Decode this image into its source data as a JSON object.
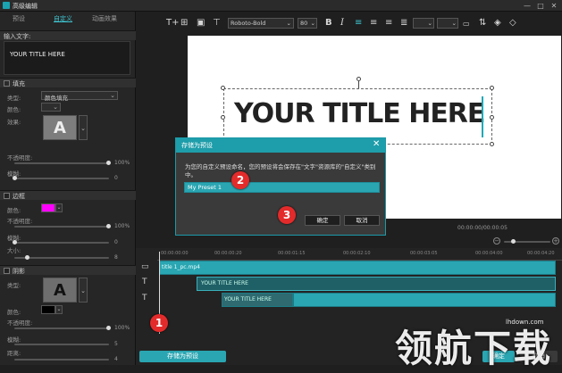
{
  "window": {
    "title": "高级编辑",
    "minimize": "—",
    "maximize": "□",
    "close": "✕"
  },
  "tabs": [
    "预设",
    "自定义",
    "动画效果"
  ],
  "left": {
    "input_section": "输入文字:",
    "input_value": "YOUR TITLE HERE",
    "fill_section": "填充",
    "type_label": "类型:",
    "type_value": "颜色填充",
    "color_label": "颜色:",
    "effect_label": "效果:",
    "opacity_label": "不透明度:",
    "opacity_value": "100%",
    "blur_label": "模糊:",
    "blur_value": "0",
    "border_section": "边框",
    "border_color_label": "颜色:",
    "border_color": "#ff00ff",
    "border_opacity_label": "不透明度:",
    "border_opacity_value": "100%",
    "border_blur_label": "模糊:",
    "border_blur_value": "0",
    "size_label": "大小:",
    "size_value": "8",
    "shadow_section": "阴影",
    "shadow_type_label": "类型:",
    "shadow_color_label": "颜色:",
    "shadow_opacity_label": "不透明度:",
    "shadow_opacity_value": "100%",
    "shadow_blur_label": "模糊:",
    "shadow_blur_value": "5",
    "distance_label": "距离:",
    "distance_value": "4",
    "save_preset": "存储为预设"
  },
  "toolbar": {
    "font": "Roboto-Bold",
    "size": "80",
    "bold": "B",
    "italic": "I"
  },
  "canvas": {
    "title": "YOUR TITLE HERE",
    "sample_letter": "A"
  },
  "time": {
    "current": "00:00:00/00:00:05"
  },
  "timeline": {
    "ruler": [
      "00:00:00:00",
      "00:00:00:20",
      "00:00:01:15",
      "00:00:02:10",
      "00:00:03:05",
      "00:00:04:00",
      "00:00:04:20"
    ],
    "track1": "title 1_pc.mp4",
    "track2": "YOUR TITLE HERE",
    "track3": "YOUR TITLE HERE"
  },
  "dialog": {
    "title": "存储为预设",
    "message": "为您的自定义预设命名，您的预设将会保存在\"文字\"资源库的\"自定义\"类别中。",
    "input_value": "My Preset 1",
    "ok": "确定",
    "cancel": "取消"
  },
  "badges": [
    "1",
    "2",
    "3"
  ],
  "footer": {
    "ok": "确定",
    "cancel": "取消"
  },
  "watermark": {
    "text": "领航下载",
    "url": "lhdown.com"
  },
  "colors": {
    "accent": "#1e9daa",
    "badge": "#e32b2b"
  }
}
